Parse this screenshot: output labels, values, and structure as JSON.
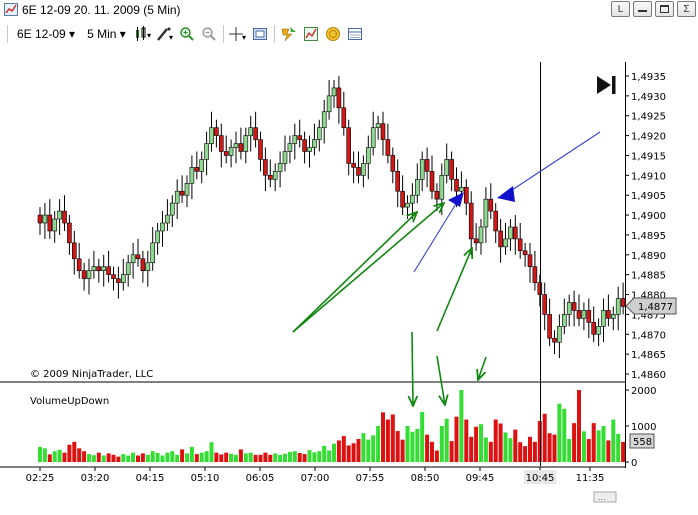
{
  "window": {
    "title": "6E 12-09  20. 11. 2009 (5 Min)",
    "buttons": [
      "L",
      "",
      "",
      "Σ"
    ]
  },
  "toolbar": {
    "instrument": "6E 12-09",
    "interval": "5 Min",
    "icons": [
      "candlestick-icon",
      "draw-pencil-icon",
      "zoom-in-icon",
      "zoom-out-icon",
      "crosshair-icon",
      "properties-icon",
      "strategy-icon",
      "indicator-icon",
      "gold-coin-icon",
      "data-box-icon"
    ]
  },
  "price_panel": {
    "copyright": "© 2009 NinjaTrader, LLC",
    "current_price_label": "1,4877",
    "goto_end_icon": "skip-to-end-icon"
  },
  "volume_panel": {
    "title": "VolumeUpDown",
    "current_volume_label": "558"
  },
  "colors": {
    "up_candle": "#90d890",
    "down_candle": "#d01818",
    "vol_up": "#33dd33",
    "vol_down": "#dd1111",
    "arrow_green": "#118811",
    "arrow_blue": "#1111cc",
    "line_blue": "#3344cc"
  },
  "chart_data": {
    "type": "candlestick",
    "price_axis": {
      "min": 1.486,
      "max": 1.4935,
      "ticks": [
        "1,4935",
        "1,4930",
        "1,4925",
        "1,4920",
        "1,4915",
        "1,4910",
        "1,4905",
        "1,4900",
        "1,4895",
        "1,4890",
        "1,4885",
        "1,4880",
        "1,4875",
        "1,4870",
        "1,4865",
        "1,4860"
      ]
    },
    "volume_axis": {
      "min": 0,
      "max": 2000,
      "ticks": [
        "2000",
        "1000",
        "0"
      ]
    },
    "time_ticks": [
      "02:25",
      "03:20",
      "04:15",
      "05:10",
      "06:05",
      "07:00",
      "07:55",
      "08:50",
      "09:45",
      "10:45",
      "11:35"
    ],
    "closes": [
      1.4898,
      1.49,
      1.4896,
      1.4899,
      1.4901,
      1.4898,
      1.4893,
      1.4889,
      1.4886,
      1.4884,
      1.4886,
      1.4887,
      1.4886,
      1.4887,
      1.4885,
      1.4884,
      1.4883,
      1.4885,
      1.4888,
      1.489,
      1.4889,
      1.4886,
      1.4888,
      1.4893,
      1.4896,
      1.4898,
      1.49,
      1.4903,
      1.4906,
      1.4905,
      1.4908,
      1.4912,
      1.4911,
      1.4914,
      1.4918,
      1.4922,
      1.492,
      1.4916,
      1.4915,
      1.4917,
      1.4918,
      1.4916,
      1.492,
      1.4922,
      1.4919,
      1.4914,
      1.491,
      1.4909,
      1.4911,
      1.4913,
      1.4916,
      1.4918,
      1.492,
      1.4919,
      1.4916,
      1.4917,
      1.4919,
      1.4922,
      1.4926,
      1.493,
      1.4932,
      1.4927,
      1.4922,
      1.4913,
      1.4912,
      1.491,
      1.4913,
      1.4917,
      1.4922,
      1.4923,
      1.4919,
      1.4915,
      1.4911,
      1.4906,
      1.4902,
      1.4903,
      1.4905,
      1.4909,
      1.4914,
      1.4911,
      1.4906,
      1.4904,
      1.491,
      1.4914,
      1.4909,
      1.4906,
      1.4907,
      1.4903,
      1.4894,
      1.4893,
      1.4897,
      1.4904,
      1.4901,
      1.4896,
      1.4892,
      1.4894,
      1.4897,
      1.4894,
      1.4891,
      1.489,
      1.4887,
      1.4883,
      1.488,
      1.4875,
      1.4869,
      1.4868,
      1.4872,
      1.4875,
      1.4878,
      1.4876,
      1.4874,
      1.4876,
      1.4873,
      1.487,
      1.4872,
      1.4876,
      1.4874,
      1.4875,
      1.4879,
      1.4877
    ],
    "volumes": [
      420,
      380,
      210,
      300,
      340,
      260,
      480,
      560,
      380,
      300,
      220,
      190,
      260,
      180,
      240,
      200,
      150,
      220,
      180,
      260,
      180,
      240,
      200,
      300,
      250,
      180,
      260,
      300,
      200,
      350,
      240,
      420,
      220,
      260,
      300,
      550,
      260,
      210,
      260,
      230,
      200,
      350,
      240,
      260,
      200,
      200,
      260,
      200,
      240,
      200,
      230,
      280,
      300,
      250,
      220,
      330,
      270,
      300,
      450,
      320,
      510,
      600,
      720,
      460,
      520,
      640,
      800,
      620,
      740,
      1000,
      1380,
      1180,
      1320,
      860,
      620,
      1000,
      840,
      920,
      1390,
      760,
      560,
      320,
      1000,
      1200,
      580,
      1260,
      2000,
      1180,
      700,
      980,
      1050,
      680,
      560,
      1180,
      1070,
      820,
      660,
      900,
      550,
      440,
      700,
      560,
      1140,
      1340,
      800,
      760,
      1620,
      1480,
      640,
      1080,
      2000,
      850,
      640,
      1080,
      880,
      1000,
      600,
      1180,
      780,
      558
    ]
  }
}
